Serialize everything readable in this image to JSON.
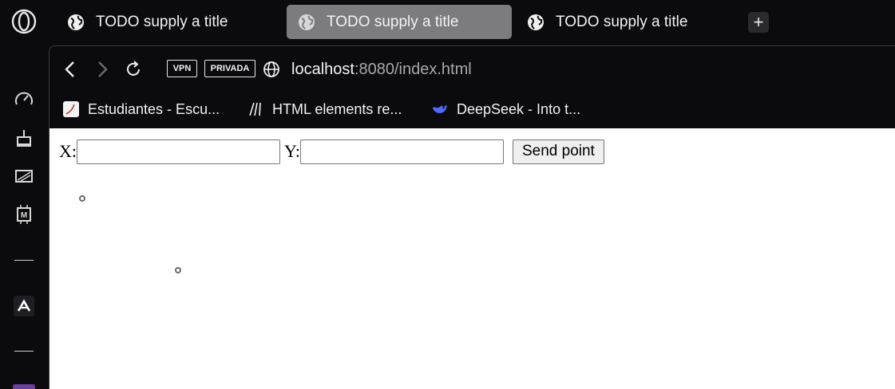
{
  "tabs": [
    {
      "title": "TODO supply a title",
      "active": false
    },
    {
      "title": "TODO supply a title",
      "active": true
    },
    {
      "title": "TODO supply a title",
      "active": false
    }
  ],
  "new_tab_label": "+",
  "address": {
    "vpn_badge": "VPN",
    "private_badge": "PRIVADA",
    "host": "localhost",
    "rest": ":8080/index.html"
  },
  "bookmarks": [
    {
      "label": "Estudiantes - Escu...",
      "icon": "page-icon"
    },
    {
      "label": "HTML elements re...",
      "icon": "mdn-icon"
    },
    {
      "label": "DeepSeek - Into t...",
      "icon": "deepseek-whale-icon"
    }
  ],
  "sidebar_icons": [
    "opera-logo-icon",
    "speed-dial-icon",
    "cleaner-icon",
    "crypto-wallet-icon",
    "ai-chip-icon",
    "aria-icon"
  ],
  "form": {
    "x_label": "X:",
    "y_label": "Y:",
    "x_value": "",
    "y_value": "",
    "submit_label": "Send point"
  },
  "colors": {
    "browser_bg": "#0b0b0d",
    "active_tab": "#7c7c7f",
    "page_bg": "#ffffff"
  }
}
